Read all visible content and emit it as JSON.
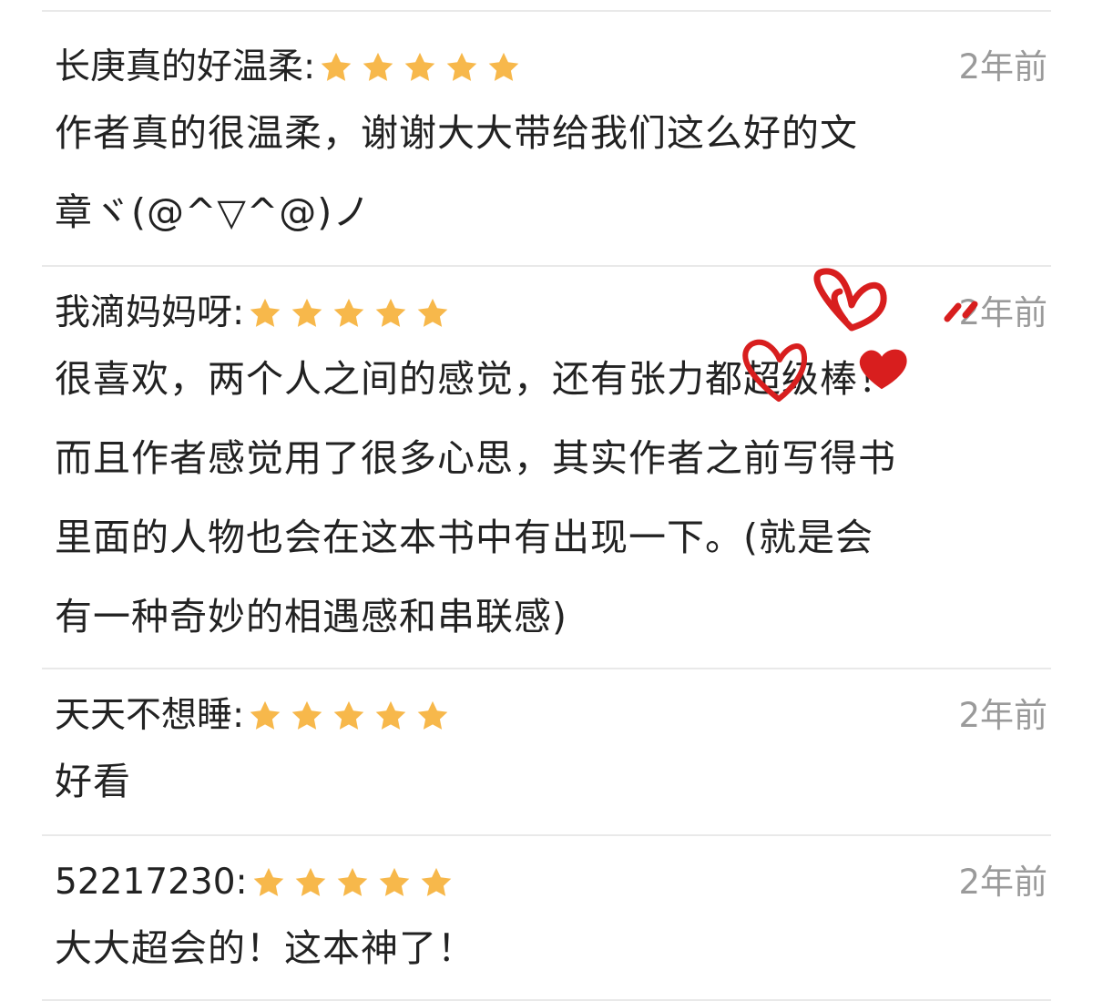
{
  "reviews": [
    {
      "user": "长庚真的好温柔:",
      "rating": 5,
      "time": "2年前",
      "lines": [
        "作者真的很温柔，谢谢大大带给我们这么好的文",
        "章ヾ(@^▽^@)ノ"
      ]
    },
    {
      "user": "我滴妈妈呀:",
      "rating": 5,
      "time": "2年前",
      "lines": [
        "很喜欢，两个人之间的感觉，还有张力都超级棒！",
        "而且作者感觉用了很多心思，其实作者之前写得书",
        "里面的人物也会在这本书中有出现一下。(就是会",
        "有一种奇妙的相遇感和串联感)"
      ]
    },
    {
      "user": "天天不想睡:",
      "rating": 5,
      "time": "2年前",
      "lines": [
        "好看"
      ]
    },
    {
      "user": "52217230:",
      "rating": 5,
      "time": "2年前",
      "lines": [
        "大大超会的！这本神了！"
      ]
    }
  ],
  "colors": {
    "star": "#F7B84B",
    "heart": "#D81E1E",
    "time": "#9A9A9A",
    "divider": "#E9E9E9"
  },
  "icons": {
    "star": "star-icon",
    "heart": "heart-doodle-icon"
  }
}
